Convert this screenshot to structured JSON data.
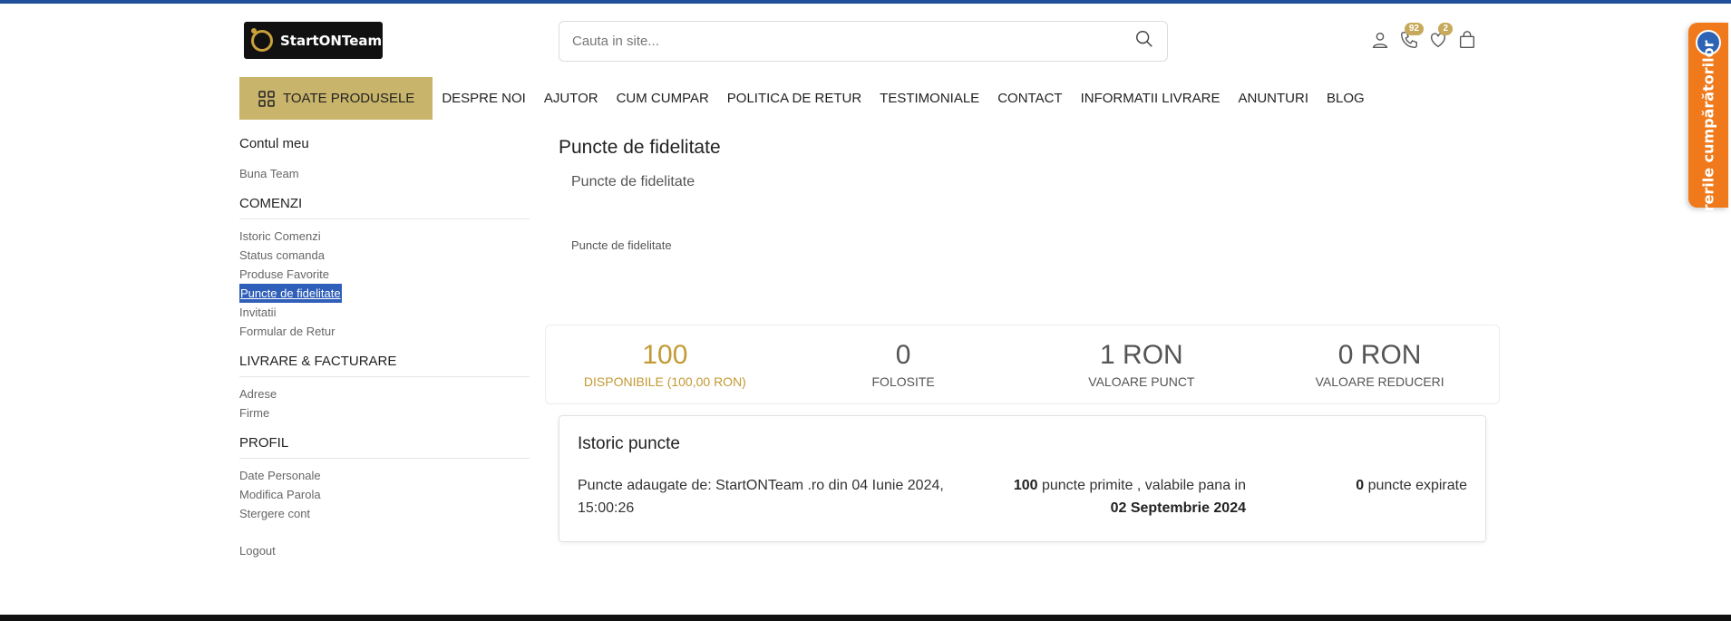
{
  "header": {
    "logo_text": "StartONTeam",
    "search_placeholder": "Cauta in site...",
    "phone_badge": "92",
    "wishlist_badge": "2"
  },
  "nav": {
    "main_label": "TOATE PRODUSELE",
    "items": [
      "DESPRE NOI",
      "AJUTOR",
      "CUM CUMPAR",
      "POLITICA DE RETUR",
      "TESTIMONIALE",
      "CONTACT",
      "INFORMATII LIVRARE",
      "ANUNTURI",
      "BLOG"
    ]
  },
  "sidebar": {
    "title": "Contul meu",
    "greeting": "Buna Team",
    "orders_heading": "COMENZI",
    "orders": [
      "Istoric Comenzi",
      "Status comanda",
      "Produse Favorite",
      "Puncte de fidelitate",
      "Invitatii",
      "Formular de Retur"
    ],
    "shipping_heading": "LIVRARE & FACTURARE",
    "shipping": [
      "Adrese",
      "Firme"
    ],
    "profile_heading": "PROFIL",
    "profile": [
      "Date Personale",
      "Modifica Parola",
      "Stergere cont"
    ],
    "logout": "Logout"
  },
  "main": {
    "title": "Puncte de fidelitate",
    "subtitle": "Puncte de fidelitate",
    "subtitle2": "Puncte de fidelitate"
  },
  "stats": [
    {
      "value": "100",
      "label": "DISPONIBILE (100,00 RON)"
    },
    {
      "value": "0",
      "label": "FOLOSITE"
    },
    {
      "value": "1 RON",
      "label": "VALOARE PUNCT"
    },
    {
      "value": "0 RON",
      "label": "VALOARE REDUCERI"
    }
  ],
  "history": {
    "title": "Istoric puncte",
    "description": "Puncte adaugate de: StartONTeam .ro din 04 Iunie 2024, 15:00:26",
    "points": "100",
    "points_text": "puncte primite , valabile pana in",
    "valid_until": "02 Septembrie 2024",
    "expired": "0",
    "expired_text": "puncte expirate"
  },
  "side_tab": {
    "label": "Parerile cumpărătorilor"
  },
  "colors": {
    "accent_gold": "#c9b46b",
    "stat_gold": "#c39a35",
    "top_bar": "#1f4f9a",
    "side_tab": "#f07a1b"
  }
}
